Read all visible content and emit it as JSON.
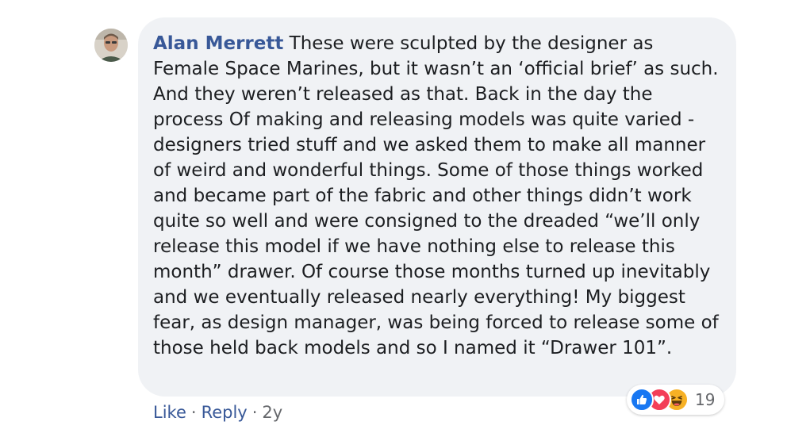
{
  "comment": {
    "author": "Alan Merrett",
    "text": "These were sculpted by the designer as Female Space Marines, but it wasn’t an ‘official brief’ as such. And they weren’t released as that. Back in the day the process Of making and releasing models was quite varied - designers tried stuff and we asked them to make all manner of weird and wonderful things. Some of those things worked and became part of the fabric and other things didn’t work quite so well and were consigned to the dreaded “we’ll only release this model if we have nothing else to release this month” drawer. Of course those months turned up inevitably and we eventually released nearly everything! My biggest fear, as design manager, was being forced to release some of those held back models and so I named it “Drawer 101”."
  },
  "reactions": {
    "icons": [
      "like-icon",
      "love-icon",
      "haha-icon"
    ],
    "count": "19"
  },
  "actions": {
    "like_label": "Like",
    "reply_label": "Reply",
    "separator": "·",
    "age": "2y"
  },
  "colors": {
    "author": "#385898",
    "bubble": "#f0f2f5",
    "like": "#1877f2",
    "love": "#f33e58",
    "haha": "#f7b125",
    "meta": "#65676b"
  }
}
